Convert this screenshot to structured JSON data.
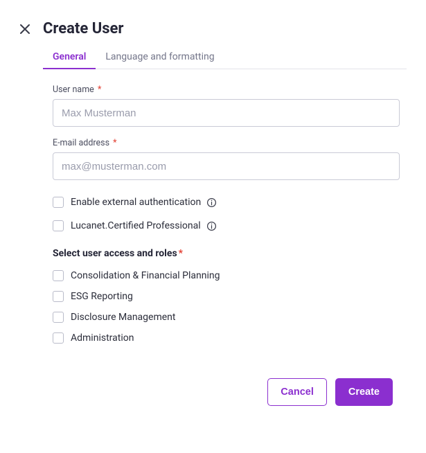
{
  "title": "Create User",
  "tabs": [
    {
      "label": "General",
      "active": true
    },
    {
      "label": "Language and formatting",
      "active": false
    }
  ],
  "fields": {
    "username": {
      "label": "User name",
      "required": true,
      "value": "",
      "placeholder": "Max Musterman"
    },
    "email": {
      "label": "E-mail address",
      "required": true,
      "value": "",
      "placeholder": "max@musterman.com"
    }
  },
  "options": {
    "external_auth": {
      "label": "Enable external authentication",
      "checked": false,
      "info": true
    },
    "certified_pro": {
      "label": "Lucanet.Certified Professional",
      "checked": false,
      "info": true
    }
  },
  "roles_section_title": "Select user access and roles",
  "roles_required": true,
  "roles": [
    {
      "label": "Consolidation & Financial Planning",
      "checked": false
    },
    {
      "label": "ESG Reporting",
      "checked": false
    },
    {
      "label": "Disclosure Management",
      "checked": false
    },
    {
      "label": "Administration",
      "checked": false
    }
  ],
  "buttons": {
    "cancel": "Cancel",
    "create": "Create"
  },
  "required_marker": "*"
}
